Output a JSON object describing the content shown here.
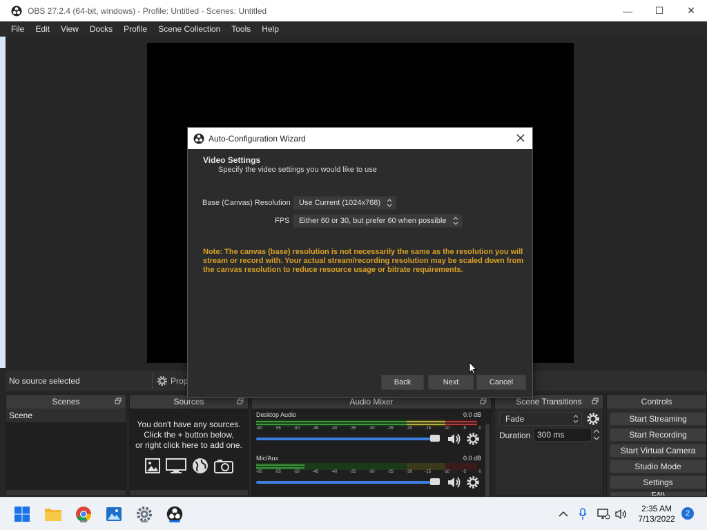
{
  "window": {
    "title": "OBS 27.2.4 (64-bit, windows) - Profile: Untitled - Scenes: Untitled",
    "minimize": "—",
    "maximize": "☐",
    "close": "✕"
  },
  "menu": [
    "File",
    "Edit",
    "View",
    "Docks",
    "Profile",
    "Scene Collection",
    "Tools",
    "Help"
  ],
  "status": {
    "no_source": "No source selected",
    "properties": "Properties"
  },
  "docks": {
    "scenes": {
      "title": "Scenes",
      "items": [
        "Scene"
      ]
    },
    "sources": {
      "title": "Sources",
      "hint_lines": [
        "You don't have any sources.",
        "Click the + button below,",
        "or right click here to add one."
      ]
    },
    "mixer": {
      "title": "Audio Mixer",
      "scale": [
        "-60",
        "-55",
        "-50",
        "-45",
        "-40",
        "-35",
        "-30",
        "-25",
        "-20",
        "-15",
        "-10",
        "-5",
        "0"
      ],
      "channels": [
        {
          "name": "Desktop Audio",
          "db": "0.0 dB",
          "volume": 1.0
        },
        {
          "name": "Mic/Aux",
          "db": "0.0 dB",
          "volume": 1.0
        }
      ]
    },
    "transitions": {
      "title": "Scene Transitions",
      "selected": "Fade",
      "duration_label": "Duration",
      "duration_value": "300 ms"
    },
    "controls": {
      "title": "Controls",
      "buttons": [
        "Start Streaming",
        "Start Recording",
        "Start Virtual Camera",
        "Studio Mode",
        "Settings",
        "Exit"
      ]
    }
  },
  "dialog": {
    "title": "Auto-Configuration Wizard",
    "heading": "Video Settings",
    "subheading": "Specify the video settings you would like to use",
    "resolution_label": "Base (Canvas) Resolution",
    "resolution_value": "Use Current (1024x768)",
    "fps_label": "FPS",
    "fps_value": "Either 60 or 30, but prefer 60 when possible",
    "note": "Note: The canvas (base) resolution is not necessarily the same as the resolution you will stream or record with. Your actual stream/recording resolution may be scaled down from the canvas resolution to reduce resource usage or bitrate requirements.",
    "back": "Back",
    "next": "Next",
    "cancel": "Cancel"
  },
  "taskbar": {
    "time": "2:35 AM",
    "date": "7/13/2022",
    "notifications": "2"
  },
  "colors": {
    "note": "#d9a126",
    "fader": "#3b7ddd",
    "meter_green": "#3c9a3c",
    "meter_yellow": "#b9b13b",
    "meter_red": "#b53b3b"
  }
}
